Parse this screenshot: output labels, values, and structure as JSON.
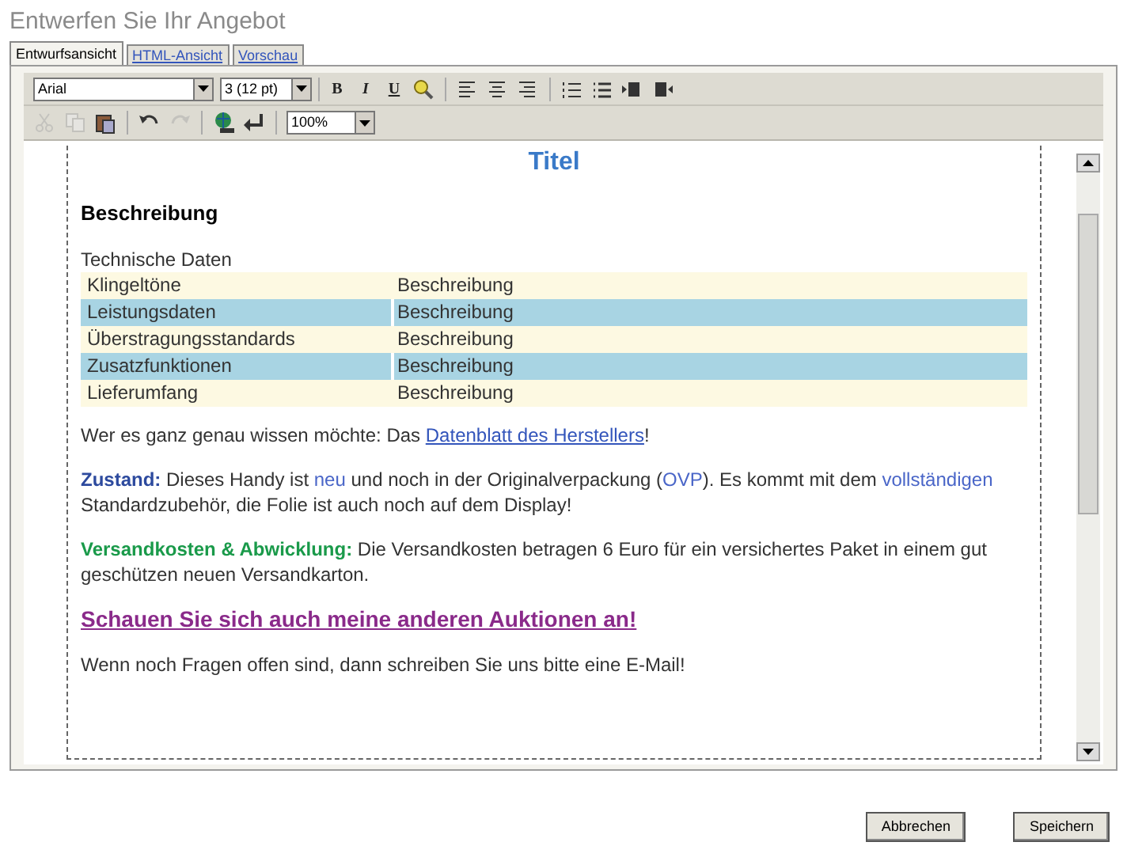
{
  "heading": "Entwerfen Sie Ihr Angebot",
  "tabs": [
    {
      "label": "Entwurfsansicht",
      "selected": true
    },
    {
      "label": "HTML-Ansicht",
      "selected": false
    },
    {
      "label": "Vorschau",
      "selected": false
    }
  ],
  "toolbar": {
    "font": "Arial",
    "size": "3 (12 pt)",
    "format_buttons": [
      "B",
      "I",
      "U"
    ],
    "row1_icons": [
      {
        "kind": "highlight",
        "disabled": false
      },
      {
        "kind": "sep"
      },
      {
        "kind": "align-left",
        "disabled": false
      },
      {
        "kind": "align-center",
        "disabled": false
      },
      {
        "kind": "align-right",
        "disabled": false
      },
      {
        "kind": "sep"
      },
      {
        "kind": "ordered-list",
        "disabled": false
      },
      {
        "kind": "bullet-list",
        "disabled": false
      },
      {
        "kind": "outdent",
        "disabled": false
      },
      {
        "kind": "indent",
        "disabled": false
      }
    ],
    "row2_icons": [
      {
        "kind": "cut",
        "disabled": true
      },
      {
        "kind": "copy",
        "disabled": true
      },
      {
        "kind": "paste",
        "disabled": false
      },
      {
        "kind": "sep"
      },
      {
        "kind": "undo",
        "disabled": false
      },
      {
        "kind": "redo",
        "disabled": true
      },
      {
        "kind": "sep"
      },
      {
        "kind": "globe",
        "disabled": false
      },
      {
        "kind": "return",
        "disabled": false
      },
      {
        "kind": "sep"
      }
    ],
    "zoom": "100%"
  },
  "document": {
    "title": "Titel",
    "section": "Beschreibung",
    "table_caption": "Technische Daten",
    "rows": [
      {
        "name": "Klingeltöne",
        "value": "Beschreibung",
        "highlighted": false
      },
      {
        "name": "Leistungsdaten",
        "value": "Beschreibung",
        "highlighted": true
      },
      {
        "name": "Überstragungsstandards",
        "value": "Beschreibung",
        "highlighted": false
      },
      {
        "name": "Zusatzfunktionen",
        "value": "Beschreibung",
        "highlighted": true
      },
      {
        "name": "Lieferumfang",
        "value": "Beschreibung",
        "highlighted": false
      }
    ],
    "paragraphs": [
      {
        "segments": [
          {
            "kind": "plain",
            "text": "Wer es ganz genau wissen möchte: Das "
          },
          {
            "kind": "link",
            "text": "Datenblatt des Herstellers"
          },
          {
            "kind": "plain",
            "text": "!"
          }
        ]
      },
      {
        "segments": [
          {
            "kind": "label-blue",
            "text": "Zustand:"
          },
          {
            "kind": "plain",
            "text": " Dieses Handy ist "
          },
          {
            "kind": "accent",
            "text": "neu"
          },
          {
            "kind": "plain",
            "text": " und noch in der Originalverpackung ("
          },
          {
            "kind": "accent",
            "text": "OVP"
          },
          {
            "kind": "plain",
            "text": "). Es kommt mit dem "
          },
          {
            "kind": "accent",
            "text": "vollständigen"
          },
          {
            "kind": "plain",
            "text": " Standardzubehör, die Folie ist auch noch auf dem Display!"
          }
        ]
      },
      {
        "segments": [
          {
            "kind": "label-green",
            "text": "Versandkosten & Abwicklung:"
          },
          {
            "kind": "plain",
            "text": " Die Versandkosten betragen 6 Euro für ein versichertes Paket in einem gut geschützen neuen Versandkarton."
          }
        ]
      },
      {
        "segments": [
          {
            "kind": "promo-link",
            "text": "Schauen Sie sich auch meine anderen Auktionen an!"
          }
        ]
      },
      {
        "segments": [
          {
            "kind": "plain",
            "text": "Wenn noch Fragen offen sind, dann schreiben Sie uns bitte eine E-Mail!"
          }
        ]
      }
    ]
  },
  "buttons": [
    "Abbrechen",
    "Speichern"
  ]
}
